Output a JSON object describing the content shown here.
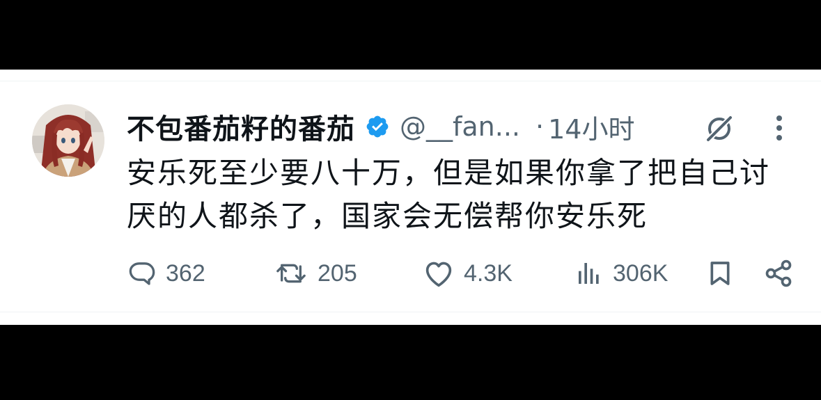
{
  "tweet": {
    "display_name": "不包番茄籽的番茄",
    "handle": "@__fan...",
    "separator": "·",
    "time_ago": "14小时",
    "text_lines": [
      "安乐死至少要八十万，但是如果你拿了把自己讨",
      "厌的人都杀了，国家会无偿帮你安乐死"
    ],
    "verified_badge_icon": "verified-check-icon",
    "grok_icon": "grok-icon",
    "more_icon": "more-vertical-icon",
    "avatar_icon": "anime-avatar"
  },
  "actions": {
    "reply": {
      "icon": "reply-icon",
      "count": "362"
    },
    "retweet": {
      "icon": "retweet-icon",
      "count": "205"
    },
    "like": {
      "icon": "heart-icon",
      "count": "4.3K"
    },
    "views": {
      "icon": "views-bar-icon",
      "count": "306K"
    },
    "bookmark": {
      "icon": "bookmark-icon"
    },
    "share": {
      "icon": "share-icon"
    }
  },
  "colors": {
    "text_primary": "#0f1419",
    "text_secondary": "#536471",
    "verified_blue": "#1d9bf0",
    "letterbox": "#000000",
    "card_bg": "#ffffff"
  }
}
